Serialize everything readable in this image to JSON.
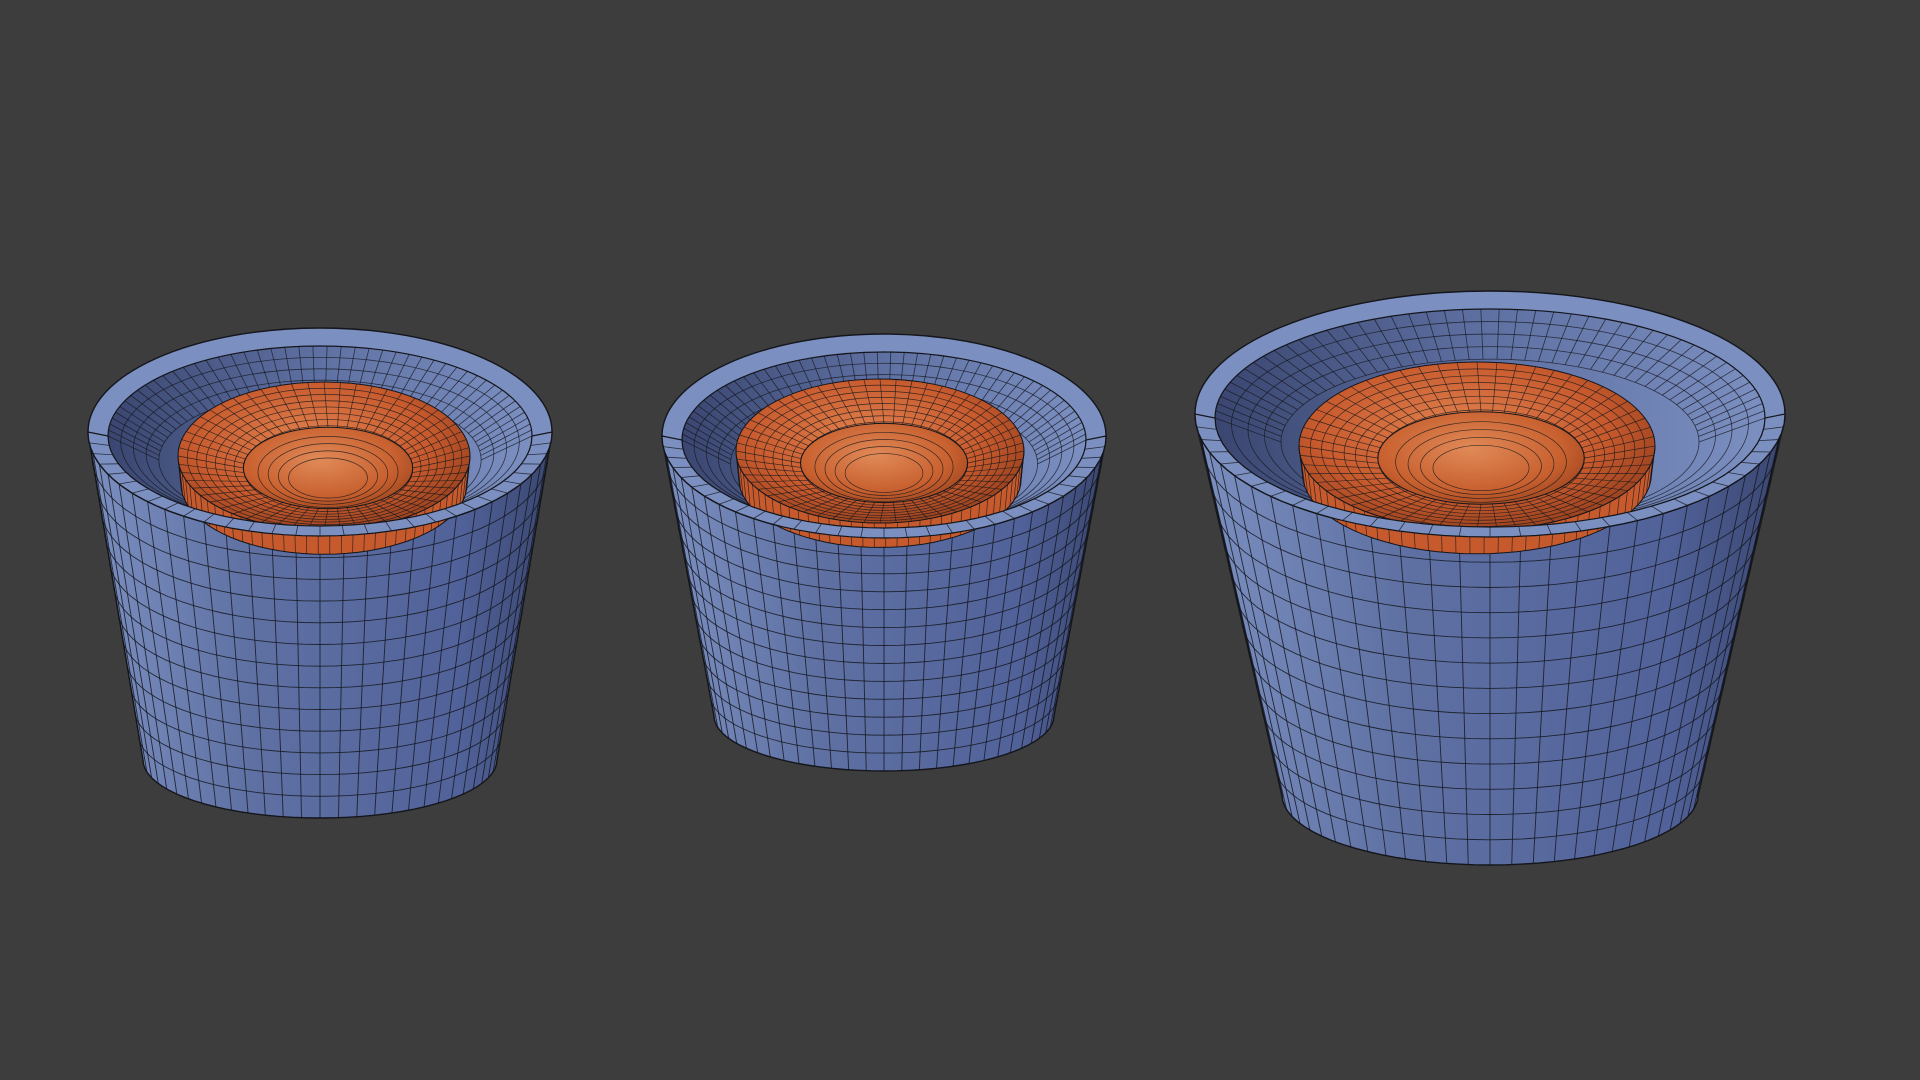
{
  "viewport": {
    "background_color": "#3d3d3d",
    "shading_mode": "solid-wireframe"
  },
  "colors": {
    "cup_light": "#7b8fc0",
    "cup_mid": "#5f71a3",
    "cup_dark": "#3a4670",
    "insert_light": "#e2824f",
    "insert_mid": "#c75a2d",
    "insert_dark": "#7d3216",
    "wire": "#14161c"
  },
  "objects": [
    {
      "name": "cup-left",
      "cup_color": "#6273a6",
      "insert_color": "#c65a2c"
    },
    {
      "name": "cup-center",
      "cup_color": "#6273a6",
      "insert_color": "#c65a2c"
    },
    {
      "name": "cup-right",
      "cup_color": "#6273a6",
      "insert_color": "#c65a2c"
    }
  ]
}
